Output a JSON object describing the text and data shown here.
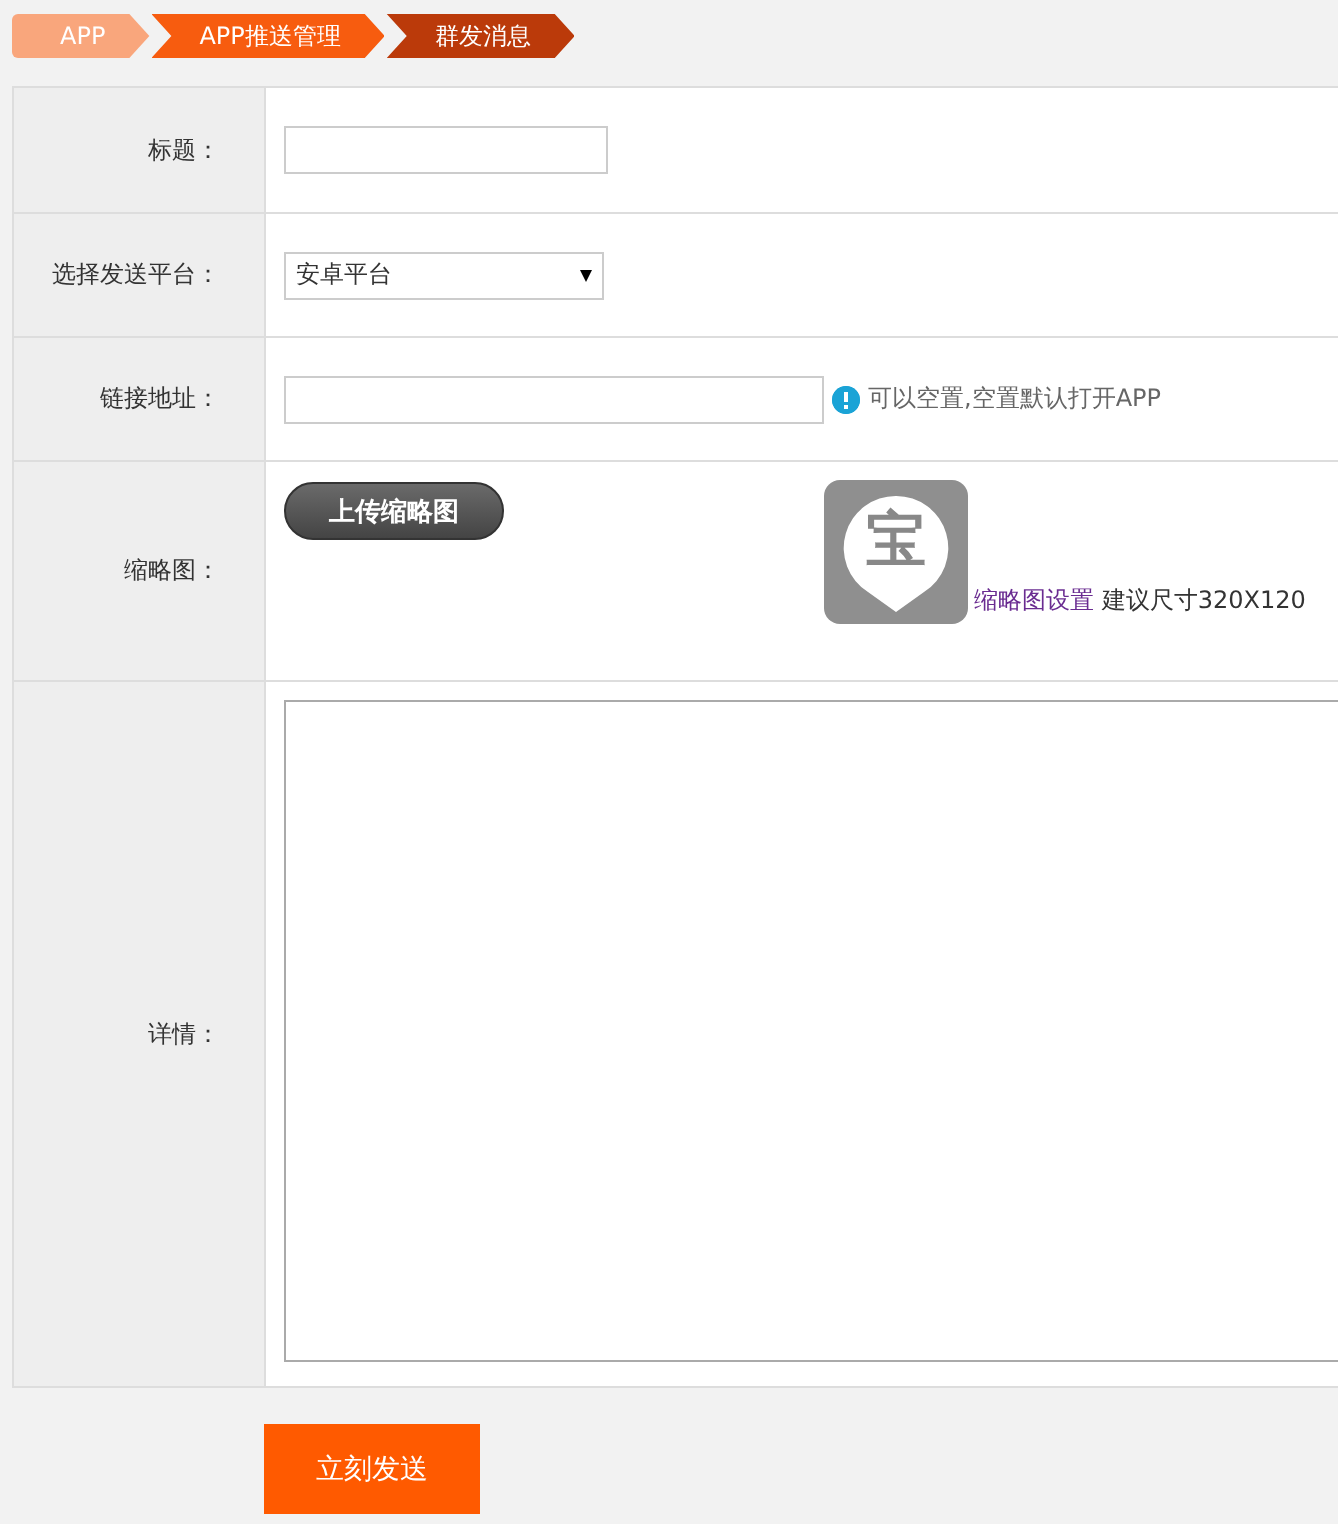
{
  "breadcrumb": [
    {
      "label": "APP",
      "color": "#f9a67c"
    },
    {
      "label": "APP推送管理",
      "color": "#f75c0f"
    },
    {
      "label": "群发消息",
      "color": "#bb3a0a"
    }
  ],
  "form": {
    "rows": [
      {
        "kind": "text",
        "label": "标题："
      },
      {
        "kind": "select",
        "label": "选择发送平台：",
        "value": "安卓平台"
      },
      {
        "kind": "link",
        "label": "链接地址：",
        "hint": "可以空置,空置默认打开APP"
      },
      {
        "kind": "thumbnail",
        "label": "缩略图：",
        "button": "上传缩略图",
        "glyph": "宝",
        "link": "缩略图设置",
        "note": "建议尺寸320X120"
      },
      {
        "kind": "textarea",
        "label": "详情："
      }
    ]
  },
  "submit": "立刻发送"
}
